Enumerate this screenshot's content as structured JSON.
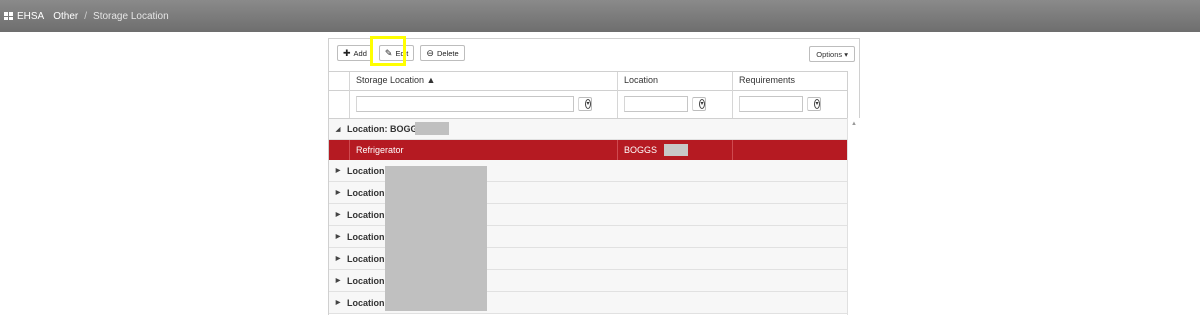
{
  "breadcrumb": {
    "app": "EHSA",
    "section": "Other",
    "separator": "/",
    "page": "Storage Location"
  },
  "toolbar": {
    "add_label": "Add",
    "edit_label": "Edit",
    "delete_label": "Delete",
    "options_label": "Options ▾"
  },
  "grid": {
    "columns": [
      "Storage Location ▲",
      "Location",
      "Requirements"
    ],
    "groups": [
      {
        "label": "Location: BOGG",
        "expanded": true
      },
      {
        "label": "Location:",
        "expanded": false
      },
      {
        "label": "Location:",
        "expanded": false
      },
      {
        "label": "Location:",
        "expanded": false
      },
      {
        "label": "Location:",
        "expanded": false
      },
      {
        "label": "Location:",
        "expanded": false
      },
      {
        "label": "Location:",
        "expanded": false
      },
      {
        "label": "Location:",
        "expanded": false
      }
    ],
    "selected_row": {
      "storage_location": "Refrigerator",
      "location": "BOGGS",
      "requirements": ""
    }
  },
  "colors": {
    "topbar": "#7a7a7a",
    "selected_row": "#b51a22",
    "highlight": "#ffff00"
  }
}
